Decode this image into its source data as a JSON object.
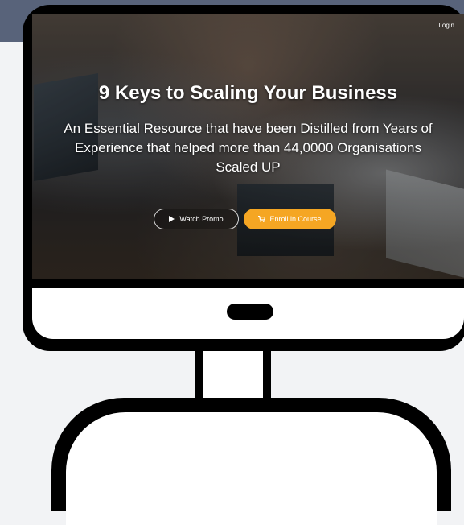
{
  "header": {
    "login_label": "Login"
  },
  "hero": {
    "title": "9 Keys to Scaling Your Business",
    "subtitle": "An Essential Resource that have been Distilled from Years of Experience that helped more than 44,0000 Organisations Scaled UP",
    "watch_label": "Watch Promo",
    "enroll_label": "Enroll in Course",
    "watch_icon": "play-icon",
    "enroll_icon": "cart-icon"
  },
  "colors": {
    "accent": "#f5a623",
    "frame": "#000000",
    "band": "#58637a",
    "background": "#f2f3f5"
  }
}
